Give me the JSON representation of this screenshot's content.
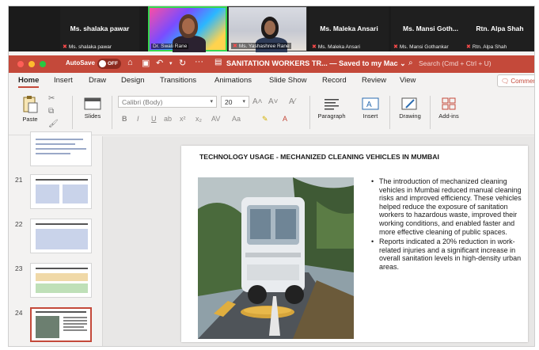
{
  "meeting": {
    "participants": [
      {
        "name": "Ms. shalaka pawar",
        "caption": "Ms. shalaka pawar"
      },
      {
        "name": "",
        "caption": "Dr. Swati Rane"
      },
      {
        "name": "",
        "caption": "Ms. Yashashree Rane"
      },
      {
        "name": "Ms. Maleka Ansari",
        "caption": "Ms. Maleka Ansari"
      },
      {
        "name": "Ms. Mansi Goth...",
        "caption": "Ms. Mansi Gothankar"
      },
      {
        "name": "Rtn. Alpa Shah",
        "caption": "Rtn. Alpa Shah"
      }
    ]
  },
  "titlebar": {
    "autosave_label": "AutoSave",
    "autosave_state": "OFF",
    "doc_title": "SANITATION WORKERS TR... — Saved to my Mac ⌄",
    "search_placeholder": "Search (Cmd + Ctrl + U)",
    "accent_color": "#c4493a"
  },
  "ribbon": {
    "tabs": [
      "Home",
      "Insert",
      "Draw",
      "Design",
      "Transitions",
      "Animations",
      "Slide Show",
      "Record",
      "Review",
      "View"
    ],
    "active_tab": "Home",
    "comments_label": "Comments",
    "paste_label": "Paste",
    "slides_label": "Slides",
    "font_name": "Calibri (Body)",
    "font_size": "20",
    "paragraph_label": "Paragraph",
    "insert_label": "Insert",
    "drawing_label": "Drawing",
    "addins_label": "Add-ins"
  },
  "thumbnails": [
    {
      "number": "",
      "selected": false
    },
    {
      "number": "21",
      "selected": false
    },
    {
      "number": "22",
      "selected": false
    },
    {
      "number": "23",
      "selected": false
    },
    {
      "number": "24",
      "selected": true
    }
  ],
  "slide": {
    "title": "TECHNOLOGY USAGE - MECHANIZED CLEANING VEHICLES IN MUMBAI",
    "bullets": [
      "The introduction of mechanized cleaning vehicles in Mumbai reduced manual cleaning risks and improved efficiency. These vehicles helped reduce the exposure of sanitation workers to hazardous waste, improved their working conditions, and enabled faster and more effective cleaning of public spaces.",
      "Reports indicated a 20% reduction in work-related injuries and a significant increase in overall sanitation levels in high-density urban areas."
    ]
  }
}
